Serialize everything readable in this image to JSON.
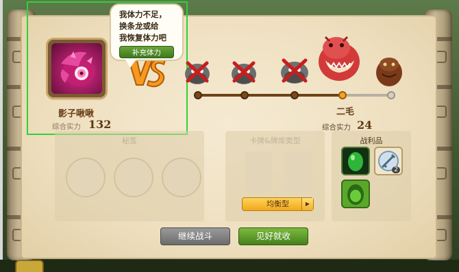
{
  "tooltip": {
    "line1": "我体力不足，",
    "line2": "换条龙或给",
    "line3": "我恢复体力吧",
    "refill_label": "补充体力"
  },
  "player": {
    "name": "影子啾啾",
    "power_label": "综合实力",
    "power": "132"
  },
  "enemies": [
    {
      "name": "defeated-enemy-1",
      "defeated": true
    },
    {
      "name": "defeated-enemy-2",
      "defeated": true
    },
    {
      "name": "defeated-enemy-3",
      "defeated": true
    },
    {
      "name": "current-boss",
      "defeated": false
    },
    {
      "name": "next-enemy",
      "defeated": false
    }
  ],
  "progress": {
    "stages_total": 5,
    "current_stage": 4
  },
  "boss": {
    "name": "二毛",
    "power_label": "综合实力",
    "power": "24"
  },
  "panels": {
    "skills_title": "秘笈",
    "cards_title": "卡牌&牌库类型",
    "deck_type": "均衡型",
    "loot_title": "战利品",
    "loot_sword_count": "2"
  },
  "buttons": {
    "continue": "继续战斗",
    "leave": "见好就收"
  },
  "colors": {
    "highlight": "#2fd13a",
    "continue_button": "#7a7a7a",
    "leave_button": "#5a9a2a",
    "deck_button": "#f5b52a"
  }
}
